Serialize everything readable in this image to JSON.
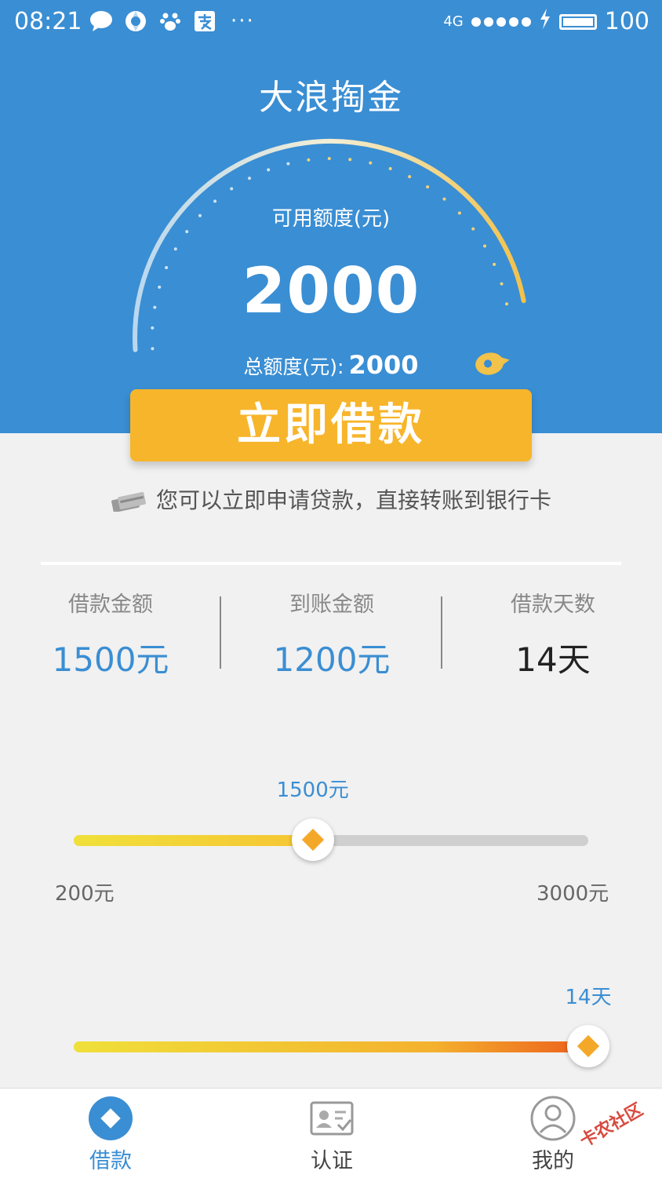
{
  "status_bar": {
    "time": "08:21",
    "notification_icons": [
      "chat-bubble-icon",
      "aperture-icon",
      "paw-icon",
      "alipay-icon"
    ],
    "more": "···",
    "network": "4G",
    "battery": "100"
  },
  "app_title": "大浪掏金",
  "gauge": {
    "available_label": "可用额度(元)",
    "available_value": "2000",
    "total_label": "总额度(元):",
    "total_value": "2000",
    "fill_fraction": 1.0
  },
  "borrow_button": "立即借款",
  "hint": "您可以立即申请贷款，直接转账到银行卡",
  "stats": [
    {
      "label": "借款金额",
      "value": "1500元"
    },
    {
      "label": "到账金额",
      "value": "1200元"
    },
    {
      "label": "借款天数",
      "value": "14天"
    }
  ],
  "amount_slider": {
    "current_label": "1500元",
    "min_label": "200元",
    "max_label": "3000元",
    "min": 200,
    "max": 3000,
    "value": 1500
  },
  "days_slider": {
    "current_label": "14天",
    "value_fraction": 1.0
  },
  "tabs": [
    {
      "label": "借款",
      "icon": "borrow-icon",
      "active": true
    },
    {
      "label": "认证",
      "icon": "certification-icon",
      "active": false
    },
    {
      "label": "我的",
      "icon": "profile-icon",
      "active": false
    }
  ],
  "watermark": "卡农社区",
  "colors": {
    "primary": "#3a8ed3",
    "accent": "#f7b52b",
    "background": "#f1f1f1"
  }
}
